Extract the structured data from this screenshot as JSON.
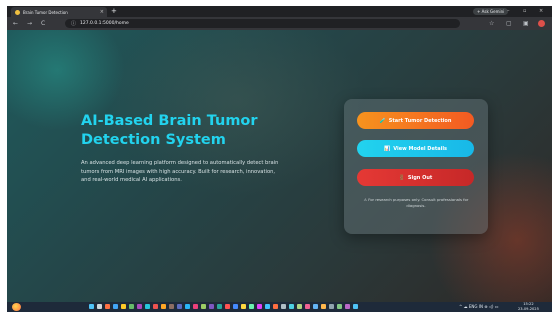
{
  "browser": {
    "tab_title": "Brain Tumor Detection",
    "tab_close": "×",
    "new_tab": "+",
    "ask_label": "+ Ask Gemini",
    "win_min": "–",
    "win_max": "▫",
    "win_close": "×",
    "back": "←",
    "forward": "→",
    "reload": "C",
    "url": "127.0.0.1:5000/home",
    "star": "☆",
    "ext": "▢",
    "split": "▣",
    "menu": "⋮"
  },
  "hero": {
    "title": "AI-Based Brain Tumor Detection System",
    "description": "An advanced deep learning platform designed to automatically detect brain tumors from MRI images with high accuracy. Built for research, innovation, and real-world medical AI applications."
  },
  "actions": {
    "start_label": "Start Tumor Detection",
    "start_icon": "🧪",
    "details_label": "View Model Details",
    "details_icon": "📊",
    "signout_label": "Sign Out",
    "signout_icon": "🚪",
    "disclaimer": "⚠ For research purposes only. Consult professionals for diagnosis."
  },
  "taskbar": {
    "tray_text": "^ ☁ ENG IN ⊕ ◁) ▭",
    "time": "15:22",
    "date": "23-09-2025"
  },
  "colors": {
    "accent_cyan": "#22d3ee",
    "start_orange": "#f7931e",
    "signout_red": "#e53935"
  }
}
